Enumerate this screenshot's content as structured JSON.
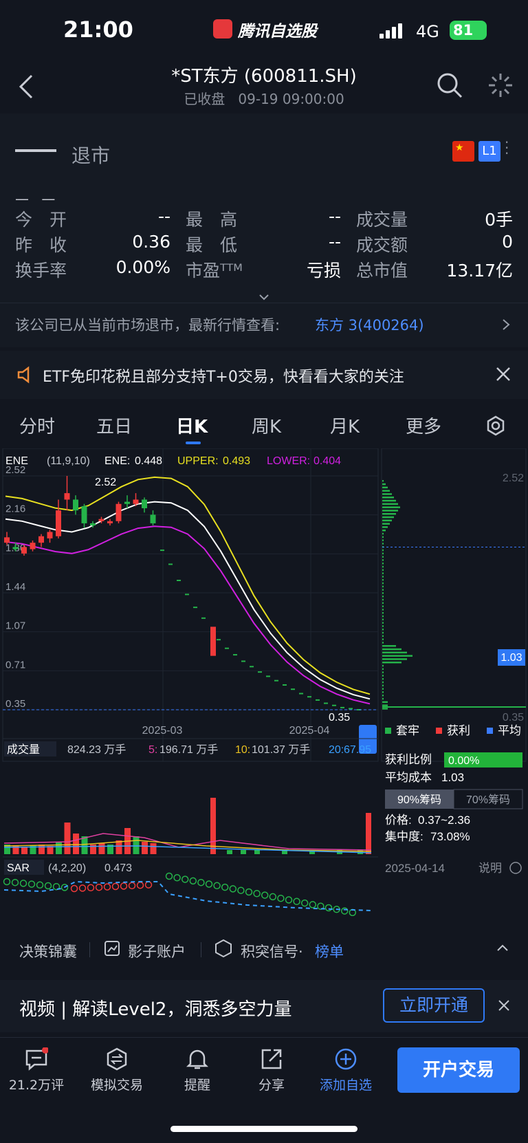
{
  "status": {
    "time": "21:00",
    "app": "腾讯自选股",
    "network": "4G",
    "battery": "81"
  },
  "header": {
    "title": "*ST东方 (600811.SH)",
    "status": "已收盘",
    "datetime": "09-19 09:00:00"
  },
  "quote": {
    "price": "—",
    "state": "退市",
    "change": "— —",
    "rows": [
      [
        {
          "k": "今　开",
          "v": "--"
        },
        {
          "k": "最　高",
          "v": "--"
        },
        {
          "k": "成交量",
          "v": "0手"
        }
      ],
      [
        {
          "k": "昨　收",
          "v": "0.36"
        },
        {
          "k": "最　低",
          "v": "--"
        },
        {
          "k": "成交额",
          "v": "0"
        }
      ],
      [
        {
          "k": "换手率",
          "v": "0.00%"
        },
        {
          "k": "市盈ᵀᵀᴹ",
          "v": "亏损"
        },
        {
          "k": "总市值",
          "v": "13.17亿"
        }
      ]
    ],
    "notice_text": "该公司已从当前市场退市，最新行情查看:",
    "notice_link": "东方 3(400264)",
    "flag_text": "★",
    "level": "L1"
  },
  "ad": {
    "text": "ETF免印花税且部分支持T+0交易，快看看大家的关注"
  },
  "tabs": [
    "分时",
    "五日",
    "日K",
    "周K",
    "月K",
    "更多"
  ],
  "active_tab": "日K",
  "chart_data": {
    "type": "candlestick",
    "indicator": {
      "name": "ENE",
      "params": "(11,9,10)",
      "ene_label": "ENE:",
      "ene": "0.448",
      "upper_label": "UPPER:",
      "upper": "0.493",
      "lower_label": "LOWER:",
      "lower": "0.404"
    },
    "y_ticks": [
      "2.52",
      "2.16",
      "1.80",
      "1.44",
      "1.07",
      "0.71",
      "0.35"
    ],
    "x_ticks": [
      "2025-03",
      "2025-04"
    ],
    "high_label": "2.52",
    "low_label": "0.35",
    "volume": {
      "name": "成交量",
      "vol": "824.23 万手",
      "ma5_label": "5:",
      "ma5": "196.71 万手",
      "ma10_label": "10:",
      "ma10": "101.37 万手",
      "ma20_label": "20:",
      "ma20": "67.95"
    },
    "sar": {
      "name": "SAR",
      "params": "(4,2,20)",
      "value": "0.473"
    },
    "chip": {
      "top": "2.52",
      "mid": "1.03",
      "bottom": "0.35",
      "legend": [
        "套牢",
        "获利",
        "平均"
      ],
      "profit_label": "获利比例",
      "profit": "0.00%",
      "avg_label": "平均成本",
      "avg": "1.03",
      "btn90": "90%筹码",
      "btn70": "70%筹码",
      "range_label": "价格:",
      "range": "0.37~2.36",
      "conc_label": "集中度:",
      "conc": "73.08%",
      "date": "2025-04-14",
      "explain": "说明"
    }
  },
  "toolbar": {
    "a": "决策锦囊",
    "b": "影子账户",
    "c": "积突信号·",
    "d": "榜单"
  },
  "promo": {
    "text": "视频 | 解读Level2，洞悉多空力量",
    "btn": "立即开通"
  },
  "bottom": {
    "comments": "21.2万评",
    "sim": "模拟交易",
    "alert": "提醒",
    "share": "分享",
    "add": "添加自选",
    "trade": "开户交易"
  }
}
